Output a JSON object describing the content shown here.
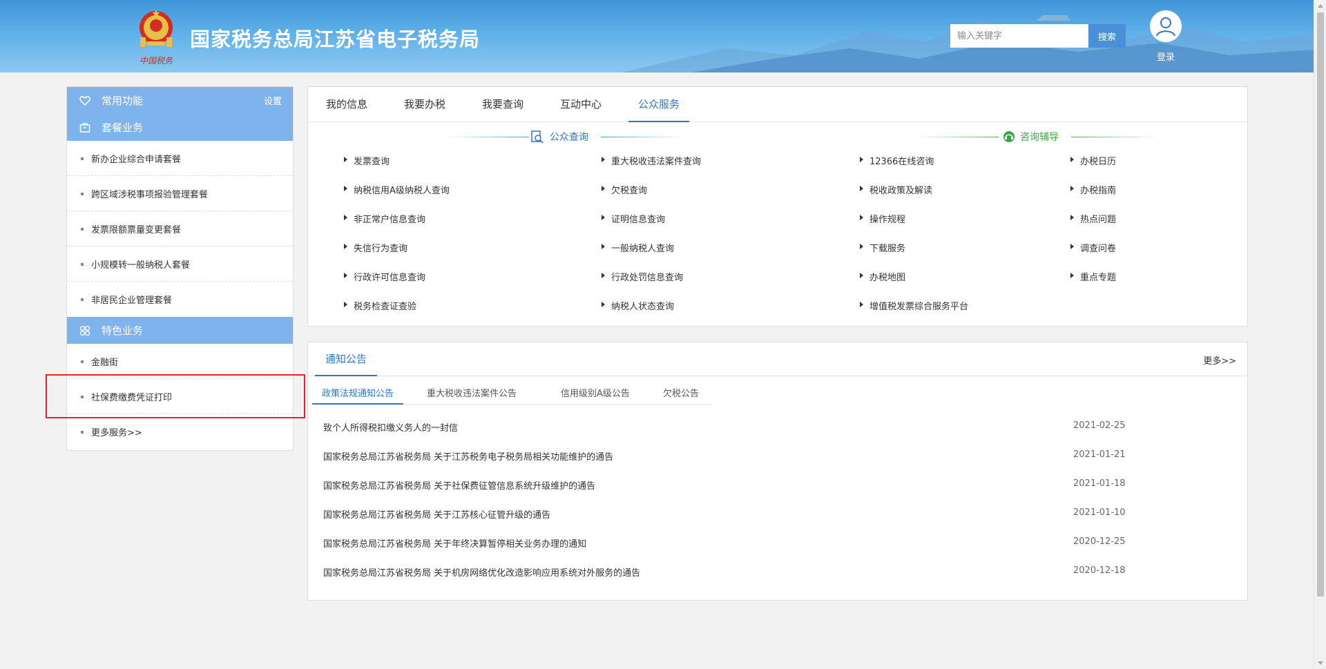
{
  "header": {
    "site_title": "国家税务总局江苏省电子税务局",
    "logo_caption": "中国税务",
    "search_placeholder": "输入关键字",
    "search_button": "搜索",
    "login_label": "登录"
  },
  "sidebar": {
    "common_title": "常用功能",
    "settings_label": "设置",
    "package_title": "套餐业务",
    "package_items": [
      "新办企业综合申请套餐",
      "跨区域涉税事项报验管理套餐",
      "发票限额票量变更套餐",
      "小规模转一般纳税人套餐",
      "非居民企业管理套餐"
    ],
    "feature_title": "特色业务",
    "feature_items": [
      "金融街",
      "社保费缴费凭证打印",
      "更多服务>>"
    ]
  },
  "main_tabs": [
    "我的信息",
    "我要办税",
    "我要查询",
    "互动中心",
    "公众服务"
  ],
  "active_tab": "公众服务",
  "public_query": {
    "title": "公众查询",
    "col1": [
      "发票查询",
      "纳税信用A级纳税人查询",
      "非正常户信息查询",
      "失信行为查询",
      "行政许可信息查询",
      "税务检查证查验"
    ],
    "col2": [
      "重大税收违法案件查询",
      "欠税查询",
      "证明信息查询",
      "一般纳税人查询",
      "行政处罚信息查询",
      "纳税人状态查询"
    ]
  },
  "consult": {
    "title": "咨询辅导",
    "col1": [
      "12366在线咨询",
      "税收政策及解读",
      "操作规程",
      "下载服务",
      "办税地图",
      "增值税发票综合服务平台"
    ],
    "col2": [
      "办税日历",
      "办税指南",
      "热点问题",
      "调查问卷",
      "重点专题"
    ]
  },
  "notice": {
    "title": "通知公告",
    "more": "更多>>",
    "subtabs": [
      "政策法规通知公告",
      "重大税收违法案件公告",
      "信用级别A级公告",
      "欠税公告"
    ],
    "items": [
      {
        "title": "致个人所得税扣缴义务人的一封信",
        "date": "2021-02-25"
      },
      {
        "title": "国家税务总局江苏省税务局 关于江苏税务电子税务局相关功能维护的通告",
        "date": "2021-01-21"
      },
      {
        "title": "国家税务总局江苏省税务局 关于社保费征管信息系统升级维护的通告",
        "date": "2021-01-18"
      },
      {
        "title": "国家税务总局江苏省税务局 关于江苏核心征管升级的通告",
        "date": "2021-01-10"
      },
      {
        "title": "国家税务总局江苏省税务局 关于年终决算暂停相关业务办理的通知",
        "date": "2020-12-25"
      },
      {
        "title": "国家税务总局江苏省税务局 关于机房网络优化改造影响应用系统对外服务的通告",
        "date": "2020-12-18"
      }
    ]
  },
  "colors": {
    "accent": "#2a77c9",
    "sidebar_header": "#7fb3ec",
    "consult_green": "#36aa42",
    "highlight_red": "#e8202a"
  }
}
